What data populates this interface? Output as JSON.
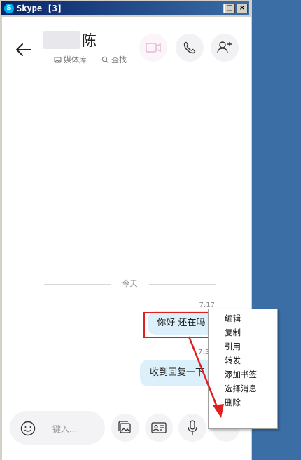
{
  "window": {
    "title": "Skype [3]",
    "app_icon_letter": "S",
    "min_glyph": "_",
    "max_glyph": "□",
    "close_glyph": "×"
  },
  "header": {
    "contact_name": "陈",
    "media_label": "媒体库",
    "search_label": "查找"
  },
  "chat": {
    "date_divider": "今天",
    "messages": [
      {
        "time": "7:17",
        "text": "你好 还在吗"
      },
      {
        "time": "7:3",
        "text": "收到回复一下"
      }
    ]
  },
  "composer": {
    "placeholder": "键入...",
    "more_glyph": "···"
  },
  "context_menu": {
    "items": [
      "编辑",
      "复制",
      "引用",
      "转发",
      "添加书签",
      "选择消息",
      "删除"
    ]
  },
  "colors": {
    "accent_red": "#e02020",
    "bubble": "#dcf0fb",
    "desktop": "#3a6ea5"
  }
}
